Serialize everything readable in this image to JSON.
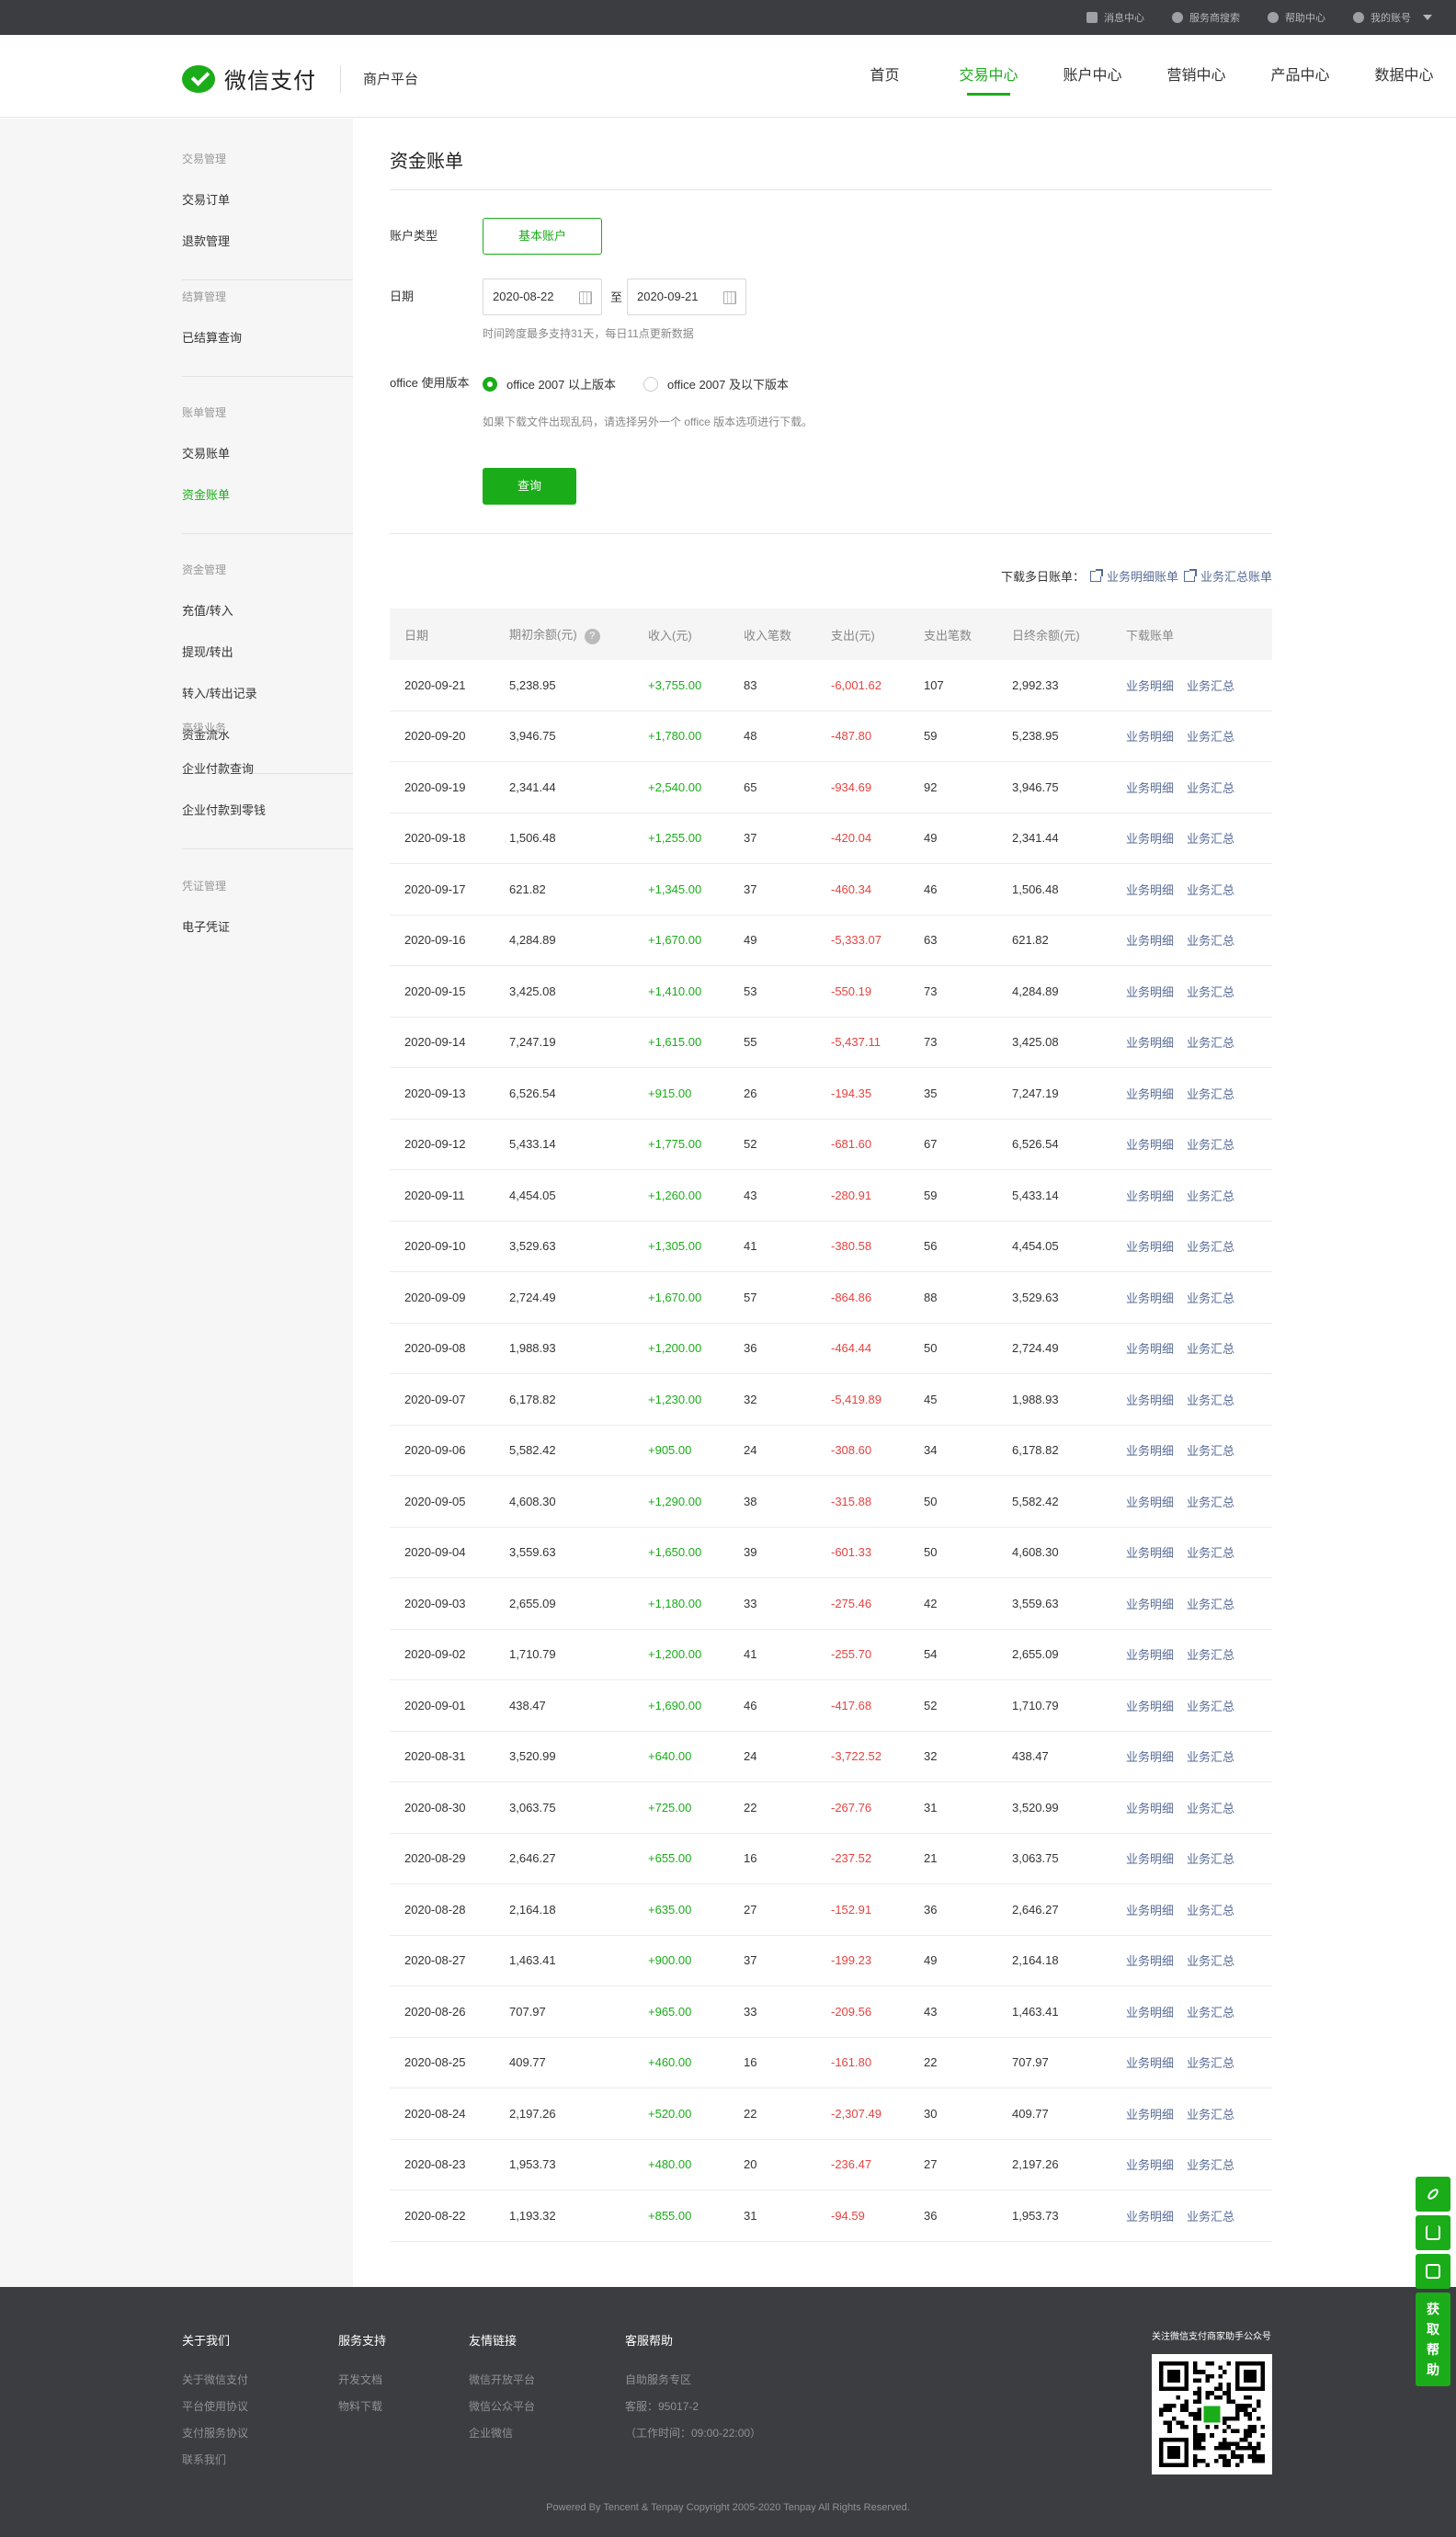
{
  "topbar": {
    "links": [
      {
        "label": "消息中心",
        "icon": "mail-icon"
      },
      {
        "label": "服务商搜索",
        "icon": "search-icon"
      },
      {
        "label": "帮助中心",
        "icon": "help-icon"
      },
      {
        "label": "我的账号",
        "icon": "user-icon"
      }
    ]
  },
  "header": {
    "brand": "微信支付",
    "subtitle": "商户平台",
    "nav": [
      "首页",
      "交易中心",
      "账户中心",
      "营销中心",
      "产品中心",
      "数据中心"
    ],
    "active_nav": "交易中心"
  },
  "sidebar": {
    "groups": [
      {
        "title": "交易管理",
        "items": [
          "交易订单",
          "退款管理"
        ]
      },
      {
        "title": "结算管理",
        "items": [
          "已结算查询"
        ]
      },
      {
        "title": "账单管理",
        "items": [
          "交易账单",
          "资金账单"
        ]
      },
      {
        "title": "资金管理",
        "items": [
          "充值/转入",
          "提现/转出",
          "转入/转出记录",
          "资金流水"
        ]
      },
      {
        "title": "高级业务",
        "items": [
          "企业付款查询",
          "企业付款到零钱"
        ]
      },
      {
        "title": "凭证管理",
        "items": [
          "电子凭证"
        ]
      }
    ],
    "active_item": "资金账单",
    "accent": "#1aad19"
  },
  "page": {
    "title": "资金账单",
    "account_type_label": "账户类型",
    "account_type_value": "基本账户",
    "date_label": "日期",
    "date_from": "2020-08-22",
    "date_to_sep": "至",
    "date_to": "2020-09-21",
    "date_hint": "时间跨度最多支持31天，每日11点更新数据",
    "office_label": "office 使用版本",
    "office_options": [
      "office 2007 以上版本",
      "office 2007 及以下版本"
    ],
    "office_selected": "office 2007 以上版本",
    "office_hint": "如果下载文件出现乱码，请选择另外一个 office 版本选项进行下载。",
    "query_button": "查询",
    "download_multi_label": "下载多日账单：",
    "download_detail": "业务明细账单",
    "download_summary": "业务汇总账单"
  },
  "table": {
    "headers": [
      "日期",
      "期初余额(元)",
      "收入(元)",
      "收入笔数",
      "支出(元)",
      "支出笔数",
      "日终余额(元)",
      "下载账单"
    ],
    "link_detail": "业务明细",
    "link_summary": "业务汇总",
    "rows": [
      [
        "2020-09-21",
        "5,238.95",
        "+3,755.00",
        "83",
        "-6,001.62",
        "107",
        "2,992.33"
      ],
      [
        "2020-09-20",
        "3,946.75",
        "+1,780.00",
        "48",
        "-487.80",
        "59",
        "5,238.95"
      ],
      [
        "2020-09-19",
        "2,341.44",
        "+2,540.00",
        "65",
        "-934.69",
        "92",
        "3,946.75"
      ],
      [
        "2020-09-18",
        "1,506.48",
        "+1,255.00",
        "37",
        "-420.04",
        "49",
        "2,341.44"
      ],
      [
        "2020-09-17",
        "621.82",
        "+1,345.00",
        "37",
        "-460.34",
        "46",
        "1,506.48"
      ],
      [
        "2020-09-16",
        "4,284.89",
        "+1,670.00",
        "49",
        "-5,333.07",
        "63",
        "621.82"
      ],
      [
        "2020-09-15",
        "3,425.08",
        "+1,410.00",
        "53",
        "-550.19",
        "73",
        "4,284.89"
      ],
      [
        "2020-09-14",
        "7,247.19",
        "+1,615.00",
        "55",
        "-5,437.11",
        "73",
        "3,425.08"
      ],
      [
        "2020-09-13",
        "6,526.54",
        "+915.00",
        "26",
        "-194.35",
        "35",
        "7,247.19"
      ],
      [
        "2020-09-12",
        "5,433.14",
        "+1,775.00",
        "52",
        "-681.60",
        "67",
        "6,526.54"
      ],
      [
        "2020-09-11",
        "4,454.05",
        "+1,260.00",
        "43",
        "-280.91",
        "59",
        "5,433.14"
      ],
      [
        "2020-09-10",
        "3,529.63",
        "+1,305.00",
        "41",
        "-380.58",
        "56",
        "4,454.05"
      ],
      [
        "2020-09-09",
        "2,724.49",
        "+1,670.00",
        "57",
        "-864.86",
        "88",
        "3,529.63"
      ],
      [
        "2020-09-08",
        "1,988.93",
        "+1,200.00",
        "36",
        "-464.44",
        "50",
        "2,724.49"
      ],
      [
        "2020-09-07",
        "6,178.82",
        "+1,230.00",
        "32",
        "-5,419.89",
        "45",
        "1,988.93"
      ],
      [
        "2020-09-06",
        "5,582.42",
        "+905.00",
        "24",
        "-308.60",
        "34",
        "6,178.82"
      ],
      [
        "2020-09-05",
        "4,608.30",
        "+1,290.00",
        "38",
        "-315.88",
        "50",
        "5,582.42"
      ],
      [
        "2020-09-04",
        "3,559.63",
        "+1,650.00",
        "39",
        "-601.33",
        "50",
        "4,608.30"
      ],
      [
        "2020-09-03",
        "2,655.09",
        "+1,180.00",
        "33",
        "-275.46",
        "42",
        "3,559.63"
      ],
      [
        "2020-09-02",
        "1,710.79",
        "+1,200.00",
        "41",
        "-255.70",
        "54",
        "2,655.09"
      ],
      [
        "2020-09-01",
        "438.47",
        "+1,690.00",
        "46",
        "-417.68",
        "52",
        "1,710.79"
      ],
      [
        "2020-08-31",
        "3,520.99",
        "+640.00",
        "24",
        "-3,722.52",
        "32",
        "438.47"
      ],
      [
        "2020-08-30",
        "3,063.75",
        "+725.00",
        "22",
        "-267.76",
        "31",
        "3,520.99"
      ],
      [
        "2020-08-29",
        "2,646.27",
        "+655.00",
        "16",
        "-237.52",
        "21",
        "3,063.75"
      ],
      [
        "2020-08-28",
        "2,164.18",
        "+635.00",
        "27",
        "-152.91",
        "36",
        "2,646.27"
      ],
      [
        "2020-08-27",
        "1,463.41",
        "+900.00",
        "37",
        "-199.23",
        "49",
        "2,164.18"
      ],
      [
        "2020-08-26",
        "707.97",
        "+965.00",
        "33",
        "-209.56",
        "43",
        "1,463.41"
      ],
      [
        "2020-08-25",
        "409.77",
        "+460.00",
        "16",
        "-161.80",
        "22",
        "707.97"
      ],
      [
        "2020-08-24",
        "2,197.26",
        "+520.00",
        "22",
        "-2,307.49",
        "30",
        "409.77"
      ],
      [
        "2020-08-23",
        "1,953.73",
        "+480.00",
        "20",
        "-236.47",
        "27",
        "2,197.26"
      ],
      [
        "2020-08-22",
        "1,193.32",
        "+855.00",
        "31",
        "-94.59",
        "36",
        "1,953.73"
      ]
    ]
  },
  "footer": {
    "columns": [
      {
        "title": "关于我们",
        "items": [
          "关于微信支付",
          "平台使用协议",
          "支付服务协议",
          "联系我们"
        ]
      },
      {
        "title": "服务支持",
        "items": [
          "开发文档",
          "物料下载"
        ]
      },
      {
        "title": "友情链接",
        "items": [
          "微信开放平台",
          "微信公众平台",
          "企业微信"
        ]
      },
      {
        "title": "客服帮助",
        "items": [
          "自助服务专区",
          "客服：95017-2",
          "（工作时间：09:00-22:00）"
        ]
      }
    ],
    "qr_title": "关注微信支付商家助手公众号",
    "copyright": "Powered By Tencent & Tenpay   Copyright 2005-2020 Tenpay All Rights Reserved."
  },
  "float_bar": {
    "icons": [
      "link-icon",
      "download-icon",
      "edit-icon"
    ],
    "help_text": "获取帮助"
  }
}
